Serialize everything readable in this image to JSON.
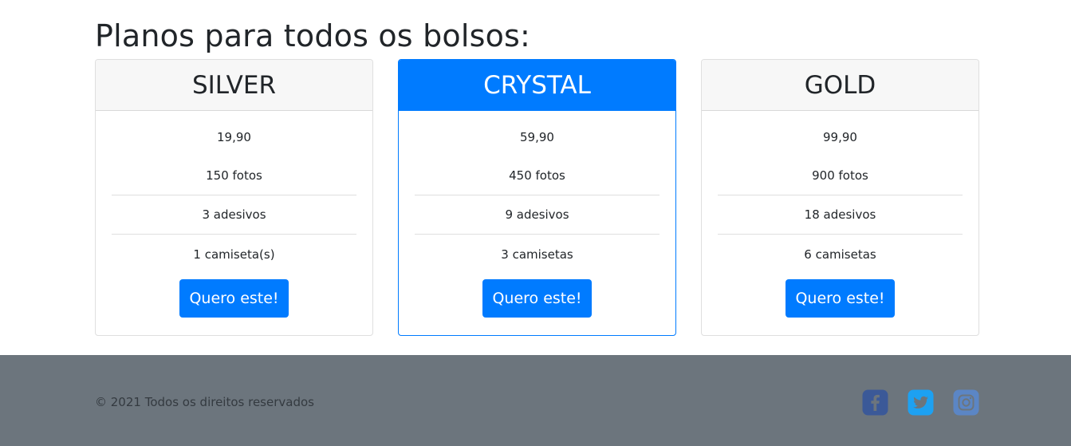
{
  "section": {
    "title": "Planos para todos os bolsos:"
  },
  "plans": [
    {
      "name": "SILVER",
      "price": "19,90",
      "features": [
        "150 fotos",
        "3 adesivos",
        "1 camiseta(s)"
      ],
      "button_label": "Quero este!"
    },
    {
      "name": "CRYSTAL",
      "price": "59,90",
      "features": [
        "450 fotos",
        "9 adesivos",
        "3 camisetas"
      ],
      "button_label": "Quero este!"
    },
    {
      "name": "GOLD",
      "price": "99,90",
      "features": [
        "900 fotos",
        "18 adesivos",
        "6 camisetas"
      ],
      "button_label": "Quero este!"
    }
  ],
  "footer": {
    "copyright": "© 2021 Todos os direitos reservados",
    "social": [
      {
        "icon": "facebook-icon",
        "color": "#3b5998"
      },
      {
        "icon": "twitter-icon",
        "color": "#1da1f2"
      },
      {
        "icon": "instagram-icon",
        "color": "#5b86c5"
      }
    ]
  },
  "colors": {
    "primary": "#007bff",
    "footer_bg": "#6c757d",
    "card_header_bg": "#f7f7f7"
  }
}
